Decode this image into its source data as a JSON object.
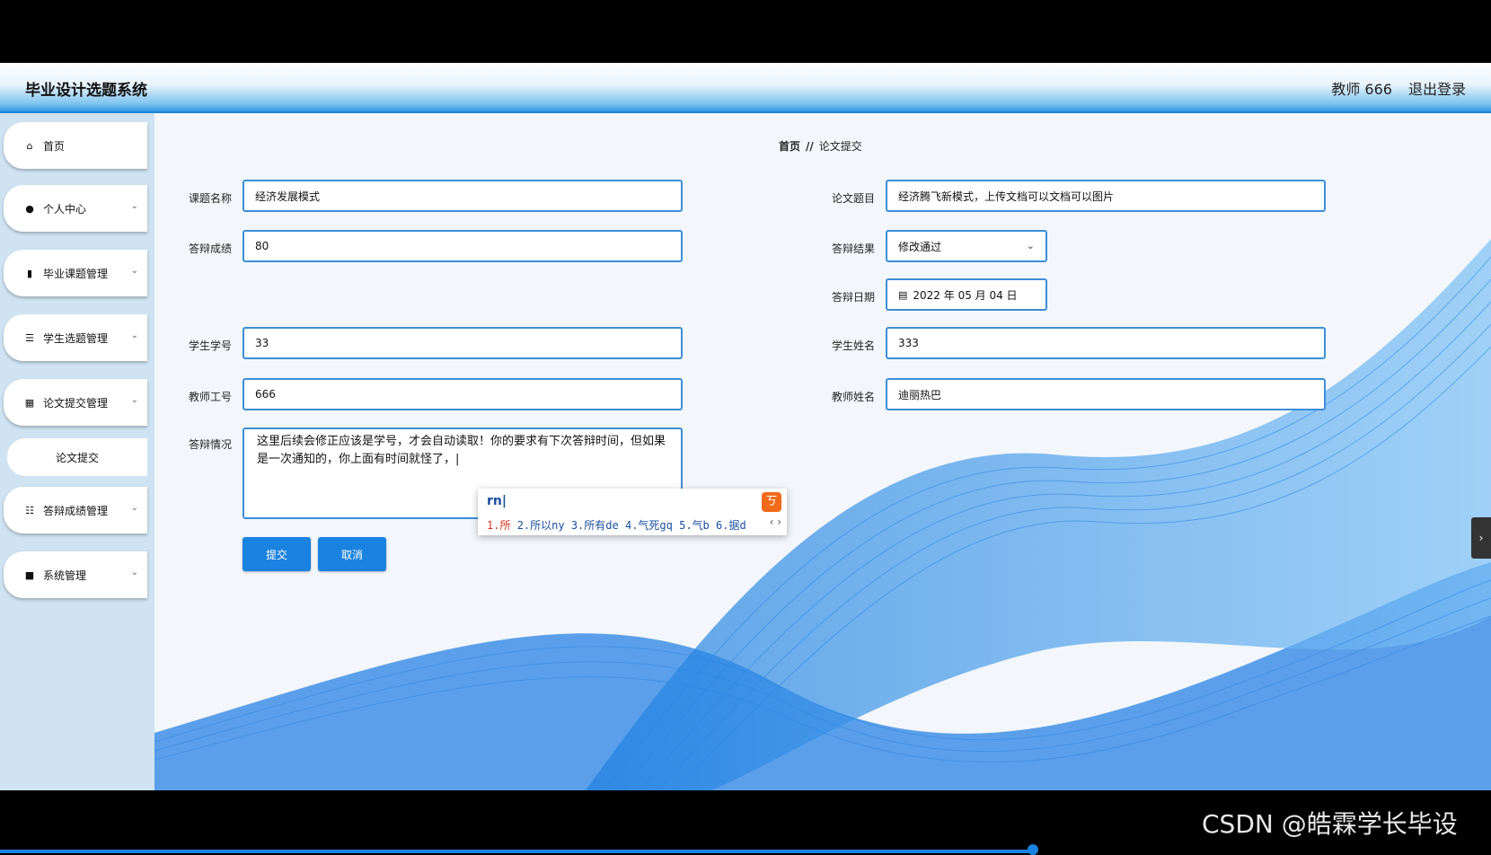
{
  "header": {
    "title": "毕业设计选题系统",
    "user": "教师 666",
    "logout": "退出登录"
  },
  "sidebar": {
    "items": [
      {
        "label": "首页",
        "icon": "home-icon"
      },
      {
        "label": "个人中心",
        "icon": "user-icon"
      },
      {
        "label": "毕业课题管理",
        "icon": "bar-chart-icon"
      },
      {
        "label": "学生选题管理",
        "icon": "list-icon"
      },
      {
        "label": "论文提交管理",
        "icon": "grid-icon"
      },
      {
        "label": "论文提交",
        "icon": ""
      },
      {
        "label": "答辩成绩管理",
        "icon": "sliders-icon"
      },
      {
        "label": "系统管理",
        "icon": "briefcase-icon"
      }
    ]
  },
  "breadcrumb": {
    "home": "首页",
    "sep": "//",
    "current": "论文提交"
  },
  "form": {
    "topic_label": "课题名称",
    "topic_value": "经济发展模式",
    "paper_label": "论文题目",
    "paper_value": "经济腾飞新模式，上传文档可以文档可以图片",
    "score_label": "答辩成绩",
    "score_value": "80",
    "result_label": "答辩结果",
    "result_value": "修改通过",
    "date_label": "答辩日期",
    "date_value": "2022 年 05 月 04 日",
    "student_no_label": "学生学号",
    "student_no_value": "33",
    "student_name_label": "学生姓名",
    "student_name_value": "333",
    "teacher_no_label": "教师工号",
    "teacher_no_value": "666",
    "teacher_name_label": "教师姓名",
    "teacher_name_value": "迪丽热巴",
    "situation_label": "答辩情况",
    "situation_value": "这里后续会修正应该是学号，才会自动读取！你的要求有下次答辩时间，但如果是一次通知的，你上面有时间就怪了，|",
    "submit": "提交",
    "cancel": "取消"
  },
  "ime": {
    "input": "rn|",
    "logo": "ㄎ",
    "candidates": [
      "1.所",
      "2.所以ny",
      "3.所有de",
      "4.气死gq",
      "5.气b",
      "6.据d"
    ],
    "nav": "‹ ›"
  },
  "watermark": "CSDN @皓霖学长毕设",
  "colors": {
    "accent": "#1a82e0",
    "border": "#3d8ed6"
  }
}
